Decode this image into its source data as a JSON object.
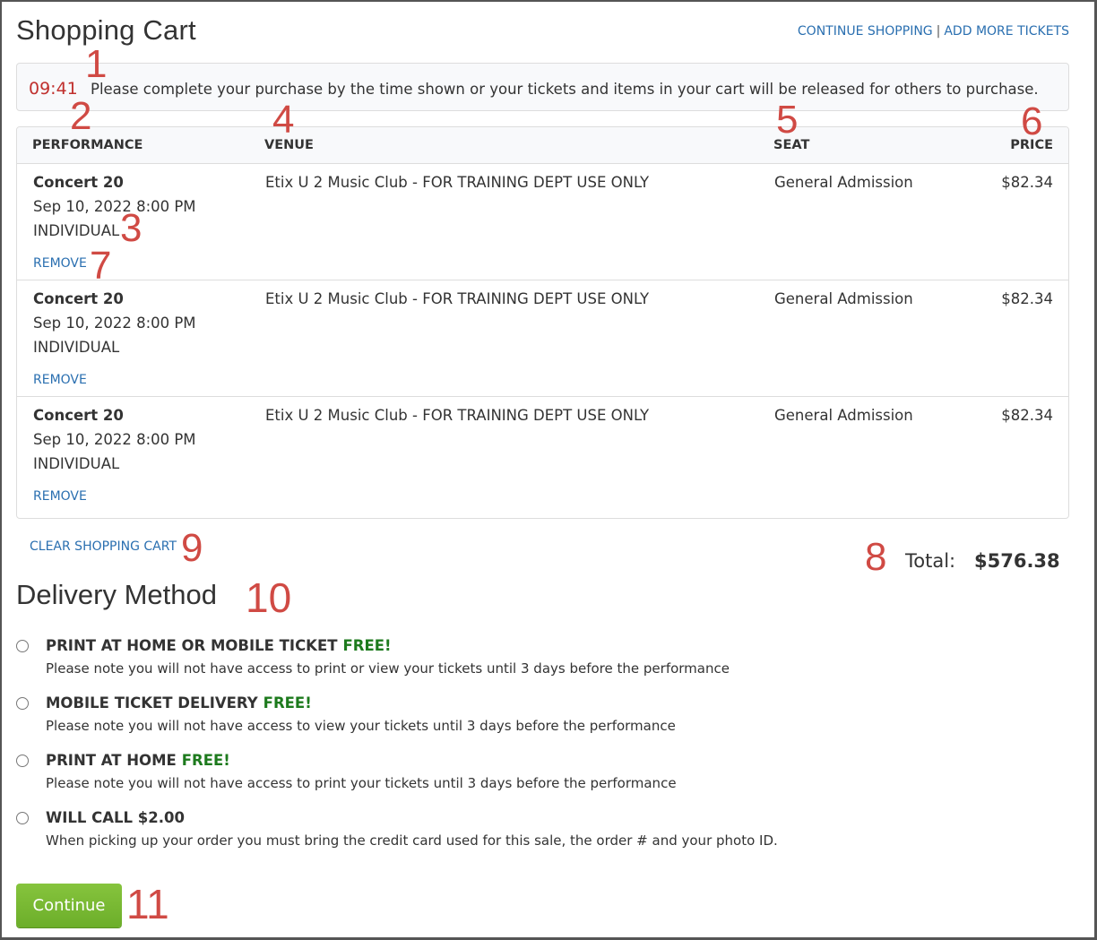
{
  "header": {
    "title": "Shopping Cart",
    "links": [
      "CONTINUE SHOPPING",
      "ADD MORE TICKETS"
    ],
    "separator": "|"
  },
  "timer": {
    "time": "09:41",
    "message": "Please complete your purchase by the time shown or your tickets and items in your cart will be released for others to purchase."
  },
  "cart": {
    "columns": [
      "PERFORMANCE",
      "VENUE",
      "SEAT",
      "PRICE"
    ],
    "rows": [
      {
        "name": "Concert 20",
        "date": "Sep 10, 2022 8:00 PM",
        "type": "INDIVIDUAL",
        "remove": "REMOVE",
        "venue": "Etix U 2 Music Club - FOR TRAINING DEPT USE ONLY",
        "seat": "General Admission",
        "price": "$82.34"
      },
      {
        "name": "Concert 20",
        "date": "Sep 10, 2022 8:00 PM",
        "type": "INDIVIDUAL",
        "remove": "REMOVE",
        "venue": "Etix U 2 Music Club - FOR TRAINING DEPT USE ONLY",
        "seat": "General Admission",
        "price": "$82.34"
      },
      {
        "name": "Concert 20",
        "date": "Sep 10, 2022 8:00 PM",
        "type": "INDIVIDUAL",
        "remove": "REMOVE",
        "venue": "Etix U 2 Music Club - FOR TRAINING DEPT USE ONLY",
        "seat": "General Admission",
        "price": "$82.34"
      }
    ],
    "clear_label": "CLEAR SHOPPING CART",
    "total_label": "Total:",
    "total_value": "$576.38"
  },
  "delivery": {
    "title": "Delivery Method",
    "options": [
      {
        "label": "PRINT AT HOME OR MOBILE TICKET",
        "badge": "FREE!",
        "note": "Please note you will not have access to print or view your tickets until 3 days before the performance"
      },
      {
        "label": "MOBILE TICKET DELIVERY",
        "badge": "FREE!",
        "note": "Please note you will not have access to view your tickets until 3 days before the performance"
      },
      {
        "label": "PRINT AT HOME",
        "badge": "FREE!",
        "note": "Please note you will not have access to print your tickets until 3 days before the performance"
      },
      {
        "label": "WILL CALL $2.00",
        "badge": "",
        "note": "When picking up your order you must bring the credit card used for this sale, the order # and your photo ID."
      }
    ],
    "continue_label": "Continue"
  },
  "annotations": [
    "1",
    "2",
    "3",
    "4",
    "5",
    "6",
    "7",
    "8",
    "9",
    "10",
    "11"
  ],
  "colors": {
    "link": "#2a6fb0",
    "timer": "#c0302d",
    "free": "#1d7a1d",
    "button": "#7ab834",
    "annotation": "#d04a44"
  }
}
